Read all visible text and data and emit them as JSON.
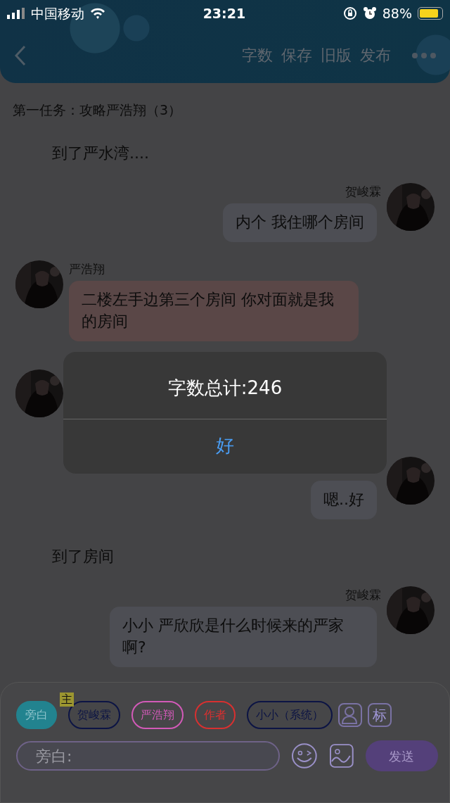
{
  "status_bar": {
    "carrier": "中国移动",
    "time": "23:21",
    "battery": "88%"
  },
  "header": {
    "actions": [
      "字数",
      "保存",
      "旧版",
      "发布"
    ]
  },
  "chapter_title": "第一任务：攻略严浩翔（3）",
  "messages": [
    {
      "kind": "narration",
      "text": "到了严水湾...."
    },
    {
      "kind": "right",
      "name": "贺峻霖",
      "text": "内个 我住哪个房间"
    },
    {
      "kind": "left",
      "name": "严浩翔",
      "text": "二楼左手边第三个房间 你对面就是我的房间",
      "color": "#5a4747"
    },
    {
      "kind": "left"
    },
    {
      "kind": "right",
      "text": "嗯..好"
    },
    {
      "kind": "narration",
      "text": "到了房间"
    },
    {
      "kind": "right",
      "name": "贺峻霖",
      "text": "小小 严欣欣是什么时候来的严家啊?"
    }
  ],
  "roles": [
    {
      "label": "旁白",
      "color": "#22838f",
      "selected": true
    },
    {
      "label": "贺峻霖",
      "color": "#0c1444",
      "selected": false,
      "badge": "主"
    },
    {
      "label": "严浩翔",
      "color": "#d25ab8",
      "selected": false
    },
    {
      "label": "作者",
      "color": "#d83030",
      "selected": false
    },
    {
      "label": "小小（系统）",
      "color": "#0c1444",
      "selected": false
    }
  ],
  "tag_button": "标",
  "input": {
    "placeholder": "旁白:"
  },
  "send_button": "发送",
  "alert": {
    "message": "字数总计:246",
    "button": "好"
  }
}
